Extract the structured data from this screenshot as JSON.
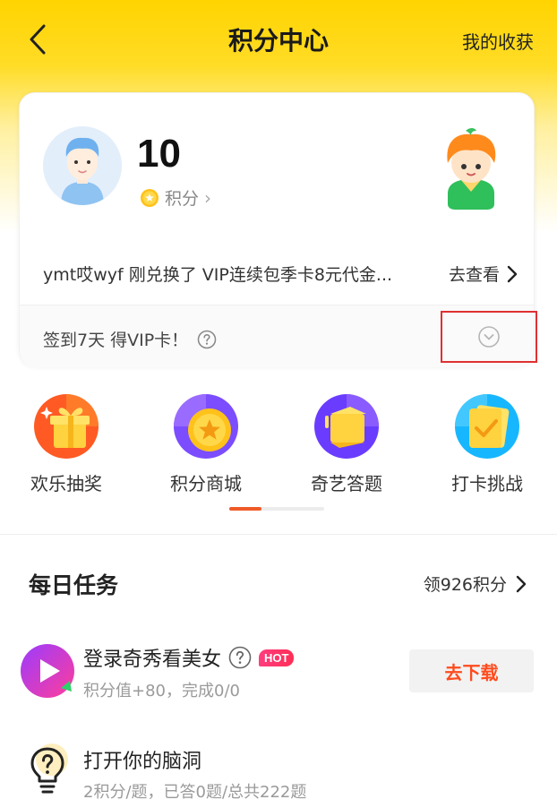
{
  "header": {
    "title": "积分中心",
    "right_link": "我的收获",
    "back_icon": "chevron-left-icon"
  },
  "account": {
    "points": "10",
    "points_label": "积分",
    "points_chevron": "›",
    "ticker_text": "ymt哎wyf 刚兑换了 VIP连续包季卡8元代金...",
    "ticker_link": "去查看"
  },
  "checkin": {
    "text": "签到7天 得VIP卡！",
    "help_icon": "question-circle-icon",
    "expand_icon": "chevron-down-circle-icon"
  },
  "quick_entries": [
    {
      "label": "欢乐抽奖",
      "icon": "gift-box-icon"
    },
    {
      "label": "积分商城",
      "icon": "star-coin-icon"
    },
    {
      "label": "奇艺答题",
      "icon": "answer-card-icon"
    },
    {
      "label": "打卡挑战",
      "icon": "checkmark-card-icon"
    }
  ],
  "daily_tasks": {
    "title": "每日任务",
    "link": "领926积分",
    "items": [
      {
        "title": "登录奇秀看美女",
        "badge": "HOT",
        "subtitle": "积分值+80，完成0/0",
        "button": "去下载",
        "icon": "play-app-icon"
      },
      {
        "title": "打开你的脑洞",
        "subtitle": "2积分/题，已答0题/总共222题",
        "icon": "lightbulb-question-icon"
      }
    ]
  },
  "colors": {
    "brand_yellow": "#ffd400",
    "accent_orange": "#f05a28",
    "button_text": "#ff4b1e",
    "highlight_border": "#e03030"
  }
}
